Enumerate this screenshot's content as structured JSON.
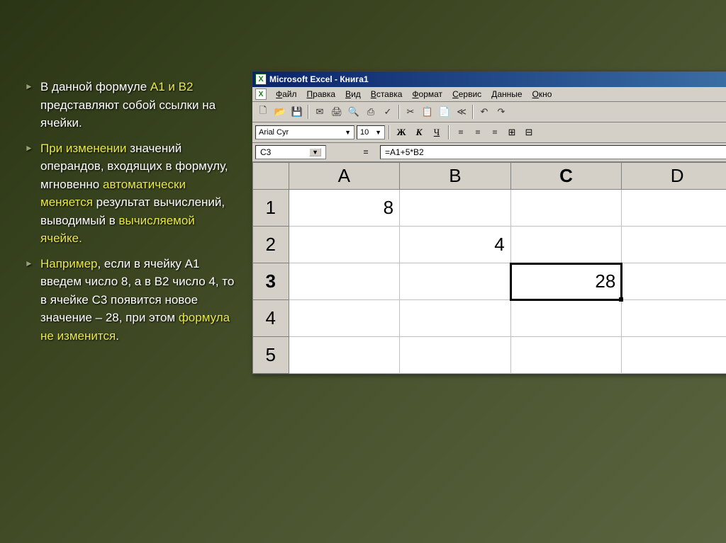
{
  "slide": {
    "bullets": [
      {
        "pre": "В данной формуле ",
        "hl": "A1 и B2",
        "post": " представляют собой ссылки на ячейки."
      },
      {
        "pre": "",
        "hl": "При изменении",
        "mid": " значений операндов, входящих в формулу, мгновенно ",
        "hl2": "автоматически меняется",
        "mid2": " результат вычислений, выводимый в ",
        "hl3": "вычисляемой ячейке.",
        "post": ""
      },
      {
        "pre": "",
        "hl": "Например",
        "mid": ", если в ячейку A1 введем число 8, а в B2 число 4, то в ячейке C3 появится новое значение – 28, при этом ",
        "hl2": "формула не изменится",
        "post": "."
      }
    ]
  },
  "title": "Microsoft Excel - Книга1",
  "appIconText": "X",
  "menus": [
    "Файл",
    "Правка",
    "Вид",
    "Вставка",
    "Формат",
    "Сервис",
    "Данные",
    "Окно"
  ],
  "toolbarIcons": [
    "🗋",
    "📂",
    "💾",
    "✉",
    "🖨",
    "🔍",
    "⎙",
    "✓",
    "✂",
    "📋",
    "📄",
    "≪",
    "↶",
    "↷"
  ],
  "font": {
    "name": "Arial Cyr",
    "size": "10"
  },
  "formatButtons": {
    "bold": "Ж",
    "italic": "К",
    "underline": "Ч"
  },
  "alignIcons": [
    "≡",
    "≡",
    "≡",
    "⊞",
    "⊟"
  ],
  "activeCellName": "C3",
  "formula": "=A1+5*B2",
  "eqLabel": "=",
  "columns": [
    "A",
    "B",
    "C",
    "D"
  ],
  "rows": [
    "1",
    "2",
    "3",
    "4",
    "5"
  ],
  "activeCol": "C",
  "activeRow": "3",
  "cells": {
    "A1": "8",
    "B2": "4",
    "C3": "28"
  }
}
